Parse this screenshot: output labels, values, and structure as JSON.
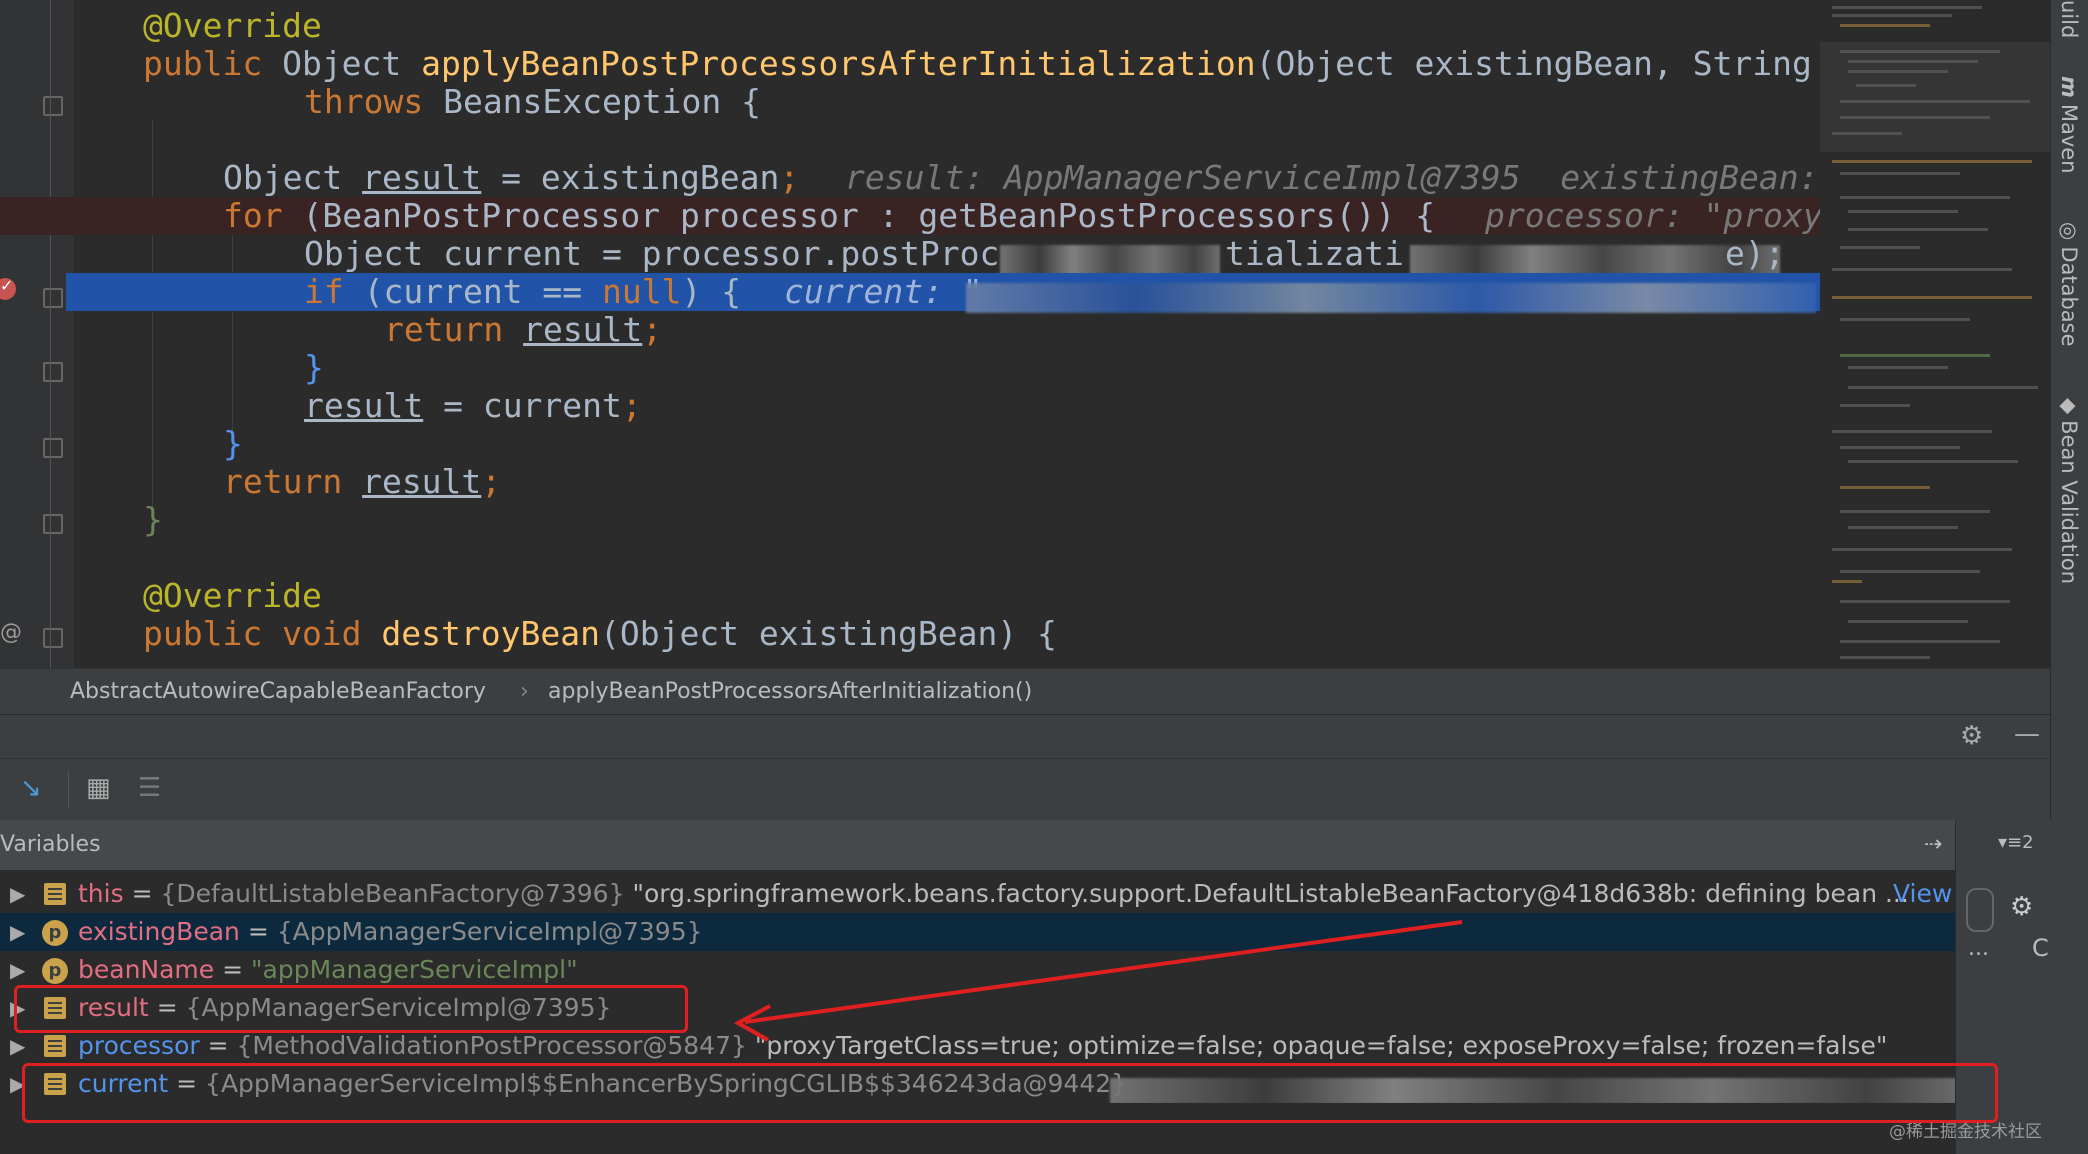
{
  "editor": {
    "lines": [
      {
        "t": "@Override"
      },
      {
        "t": "public Object applyBeanPostProcessorsAfterInitialization(Object existingBean, String"
      },
      {
        "t": "throws BeansException {"
      },
      {
        "t": ""
      },
      {
        "t": "Object result = existingBean;",
        "hint": "result: AppManagerServiceImpl@7395  existingBean:"
      },
      {
        "t": "for (BeanPostProcessor processor : getBeanPostProcessors()) {",
        "hint": "processor: \"proxy"
      },
      {
        "t": "Object current = processor.postProc",
        "tail1": "tializati",
        "tail2": "e);"
      },
      {
        "t": "if (current == null) {",
        "hint": "current: \""
      },
      {
        "t": "return result;"
      },
      {
        "t": "}"
      },
      {
        "t": "result = current;"
      },
      {
        "t": "}"
      },
      {
        "t": "return result;"
      },
      {
        "t": "}"
      },
      {
        "t": ""
      },
      {
        "t": "@Override"
      },
      {
        "t": "public void destroyBean(Object existingBean) {"
      }
    ],
    "gutter_at": "@"
  },
  "breadcrumb": {
    "class": "AbstractAutowireCapableBeanFactory",
    "separator": "›",
    "method": "applyBeanPostProcessorsAfterInitialization()"
  },
  "debug": {
    "settings_icon": "gear-icon",
    "minimize_icon": "minimize-icon",
    "variables_title": "Variables",
    "layout_hint": "⇢",
    "count_label": "▾≡2",
    "side_more": "...",
    "side_c": "C",
    "variables": [
      {
        "name": "this",
        "eq": "=",
        "type": "{DefaultListableBeanFactory@7396}",
        "value": "\"org.springframework.beans.factory.support.DefaultListableBeanFactory@418d638b: defining bean ...",
        "link": "View",
        "icon": "field"
      },
      {
        "name": "existingBean",
        "eq": "=",
        "type": "{AppManagerServiceImpl@7395}",
        "value": "",
        "icon": "param"
      },
      {
        "name": "beanName",
        "eq": "=",
        "type": "",
        "value": "\"appManagerServiceImpl\"",
        "icon": "param"
      },
      {
        "name": "result",
        "eq": "=",
        "type": "{AppManagerServiceImpl@7395}",
        "value": "",
        "icon": "field"
      },
      {
        "name": "processor",
        "eq": "=",
        "type": "{MethodValidationPostProcessor@5847}",
        "value": "\"proxyTargetClass=true; optimize=false; opaque=false; exposeProxy=false; frozen=false\"",
        "icon": "field"
      },
      {
        "name": "current",
        "eq": "=",
        "type": "{AppManagerServiceImpl$$EnhancerBySpringCGLIB$$346243da@9442}",
        "value": "",
        "icon": "field"
      }
    ]
  },
  "right_strip": {
    "maven": "Maven",
    "database": "Database",
    "bean_validation": "Bean Validation",
    "top_label": "uild"
  },
  "watermark": "@稀土掘金技术社区",
  "colors": {
    "editor_bg": "#2b2b2b",
    "keyword": "#cc7832",
    "annotation": "#bbb529",
    "method": "#ffc66d",
    "string": "#6a8759",
    "selection": "#2154a8",
    "highlight_box": "#e02020"
  }
}
